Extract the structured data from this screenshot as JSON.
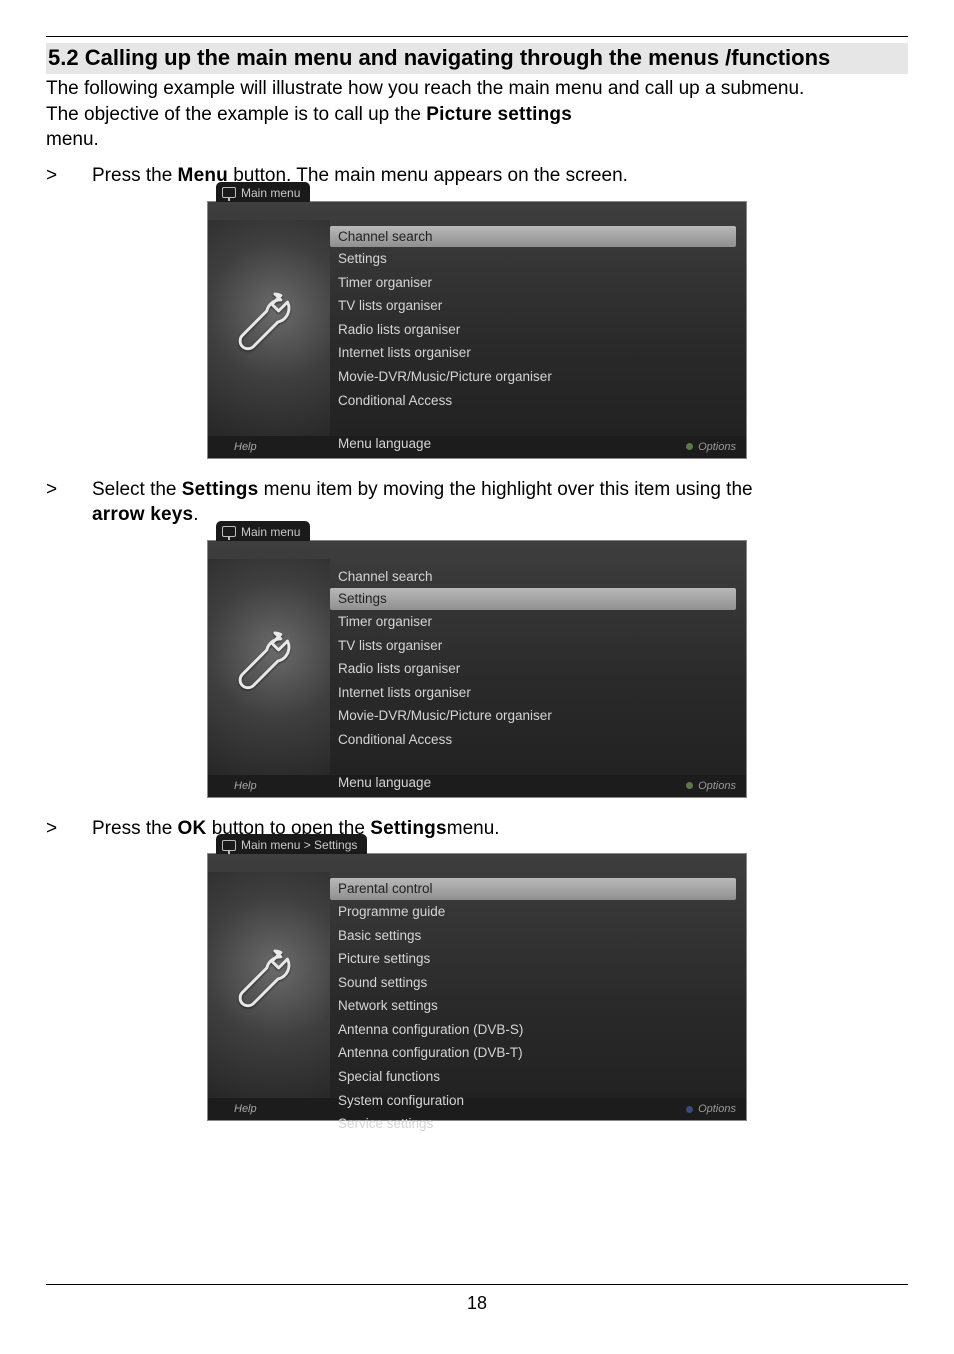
{
  "page_number": "18",
  "heading": "5.2 Calling up the main menu and navigating through the menus /functions",
  "intro_line1": "The following example will illustrate how you reach the main menu and call up a submenu.",
  "intro_line2_pre": "The objective of the example is to call up the ",
  "intro_line2_bold": "Picture settings",
  "intro_line3": "menu.",
  "step1_pre": "Press the ",
  "step1_bold": "Menu",
  "step1_post": " button. The main menu appears on the screen.",
  "step2_pre": "Select the ",
  "step2_bold": "Settings",
  "step2_mid": " menu item by moving the highlight over this item using the ",
  "step2_bold2": "arrow keys",
  "step2_post": ".",
  "step3_pre": "Press the ",
  "step3_bold": "OK",
  "step3_mid": " button to open the ",
  "step3_bold2": "Settings",
  "step3_post": "menu.",
  "marker": ">",
  "menu1": {
    "crumb": "Main menu",
    "items": [
      "Channel search",
      "Settings",
      "Timer organiser",
      "TV lists organiser",
      "Radio lists organiser",
      "Internet lists organiser",
      "Movie-DVR/Music/Picture organiser",
      "Conditional Access"
    ],
    "language_item": "Menu language",
    "highlight_index": 0,
    "help": "Help",
    "options": "Options"
  },
  "menu2": {
    "crumb": "Main menu",
    "items": [
      "Channel search",
      "Settings",
      "Timer organiser",
      "TV lists organiser",
      "Radio lists organiser",
      "Internet lists organiser",
      "Movie-DVR/Music/Picture organiser",
      "Conditional Access"
    ],
    "language_item": "Menu language",
    "highlight_index": 1,
    "help": "Help",
    "options": "Options"
  },
  "menu3": {
    "crumb": "Main menu > Settings",
    "items": [
      "Parental control",
      "Programme guide",
      "Basic settings",
      "Picture settings",
      "Sound settings",
      "Network settings",
      "Antenna configuration (DVB-S)",
      "Antenna configuration (DVB-T)",
      "Special functions",
      "System configuration",
      "Service settings"
    ],
    "highlight_index": 0,
    "help": "Help",
    "options": "Options"
  }
}
